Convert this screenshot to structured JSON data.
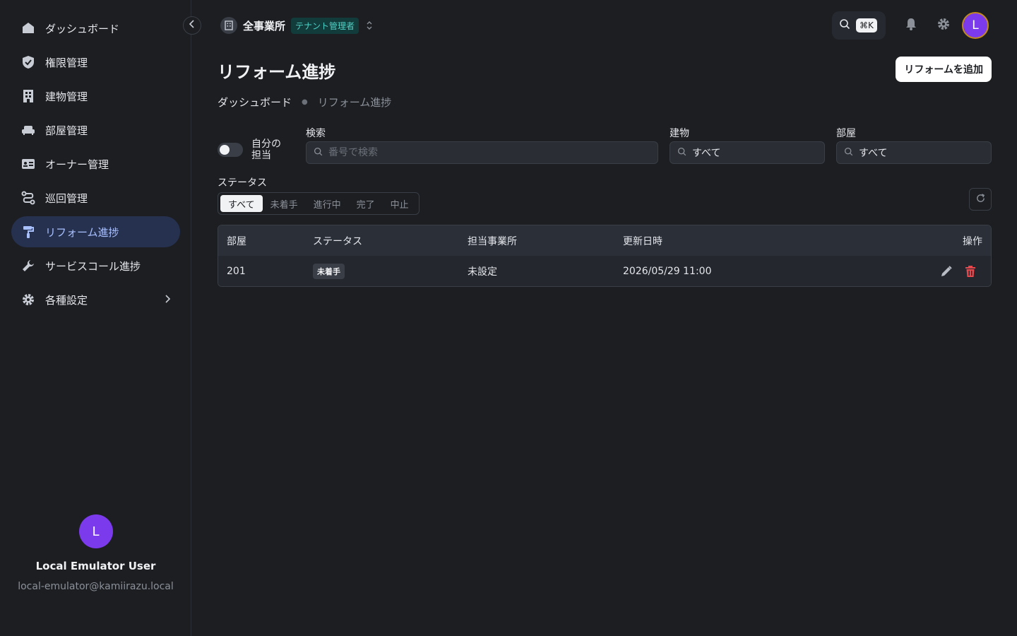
{
  "sidebar": {
    "items": [
      {
        "label": "ダッシュボード",
        "icon": "home-icon"
      },
      {
        "label": "権限管理",
        "icon": "shield-icon"
      },
      {
        "label": "建物管理",
        "icon": "building-icon"
      },
      {
        "label": "部屋管理",
        "icon": "sofa-icon"
      },
      {
        "label": "オーナー管理",
        "icon": "id-card-icon"
      },
      {
        "label": "巡回管理",
        "icon": "route-icon"
      },
      {
        "label": "リフォーム進捗",
        "icon": "paint-roller-icon",
        "active": true
      },
      {
        "label": "サービスコール進捗",
        "icon": "wrench-icon"
      },
      {
        "label": "各種設定",
        "icon": "gear-icon"
      }
    ],
    "user": {
      "initial": "L",
      "name": "Local Emulator User",
      "email": "local-emulator@kamiirazu.local"
    }
  },
  "header": {
    "office_name": "全事業所",
    "role_badge": "テナント管理者",
    "shortcut": "⌘K",
    "avatar_initial": "L"
  },
  "page": {
    "title": "リフォーム進捗",
    "add_button": "リフォームを追加",
    "breadcrumb": [
      "ダッシュボード",
      "リフォーム進捗"
    ]
  },
  "filters": {
    "toggle_label": "自分の担当",
    "search_label": "検索",
    "search_placeholder": "番号で検索",
    "building_label": "建物",
    "building_value": "すべて",
    "room_label": "部屋",
    "room_value": "すべて",
    "status_label": "ステータス",
    "status_options": [
      "すべて",
      "未着手",
      "進行中",
      "完了",
      "中止"
    ]
  },
  "table": {
    "headers": [
      "部屋",
      "ステータス",
      "担当事業所",
      "更新日時",
      "操作"
    ],
    "rows": [
      {
        "room": "201",
        "status": "未着手",
        "office": "未設定",
        "updated": "2026/05/29 11:00"
      }
    ]
  },
  "colors": {
    "accent_active_bg": "#263150",
    "accent_active_text": "#a9c0ff",
    "avatar": "#7c3aed",
    "role_badge_text": "#4fd1c5",
    "delete": "#e5484d"
  }
}
